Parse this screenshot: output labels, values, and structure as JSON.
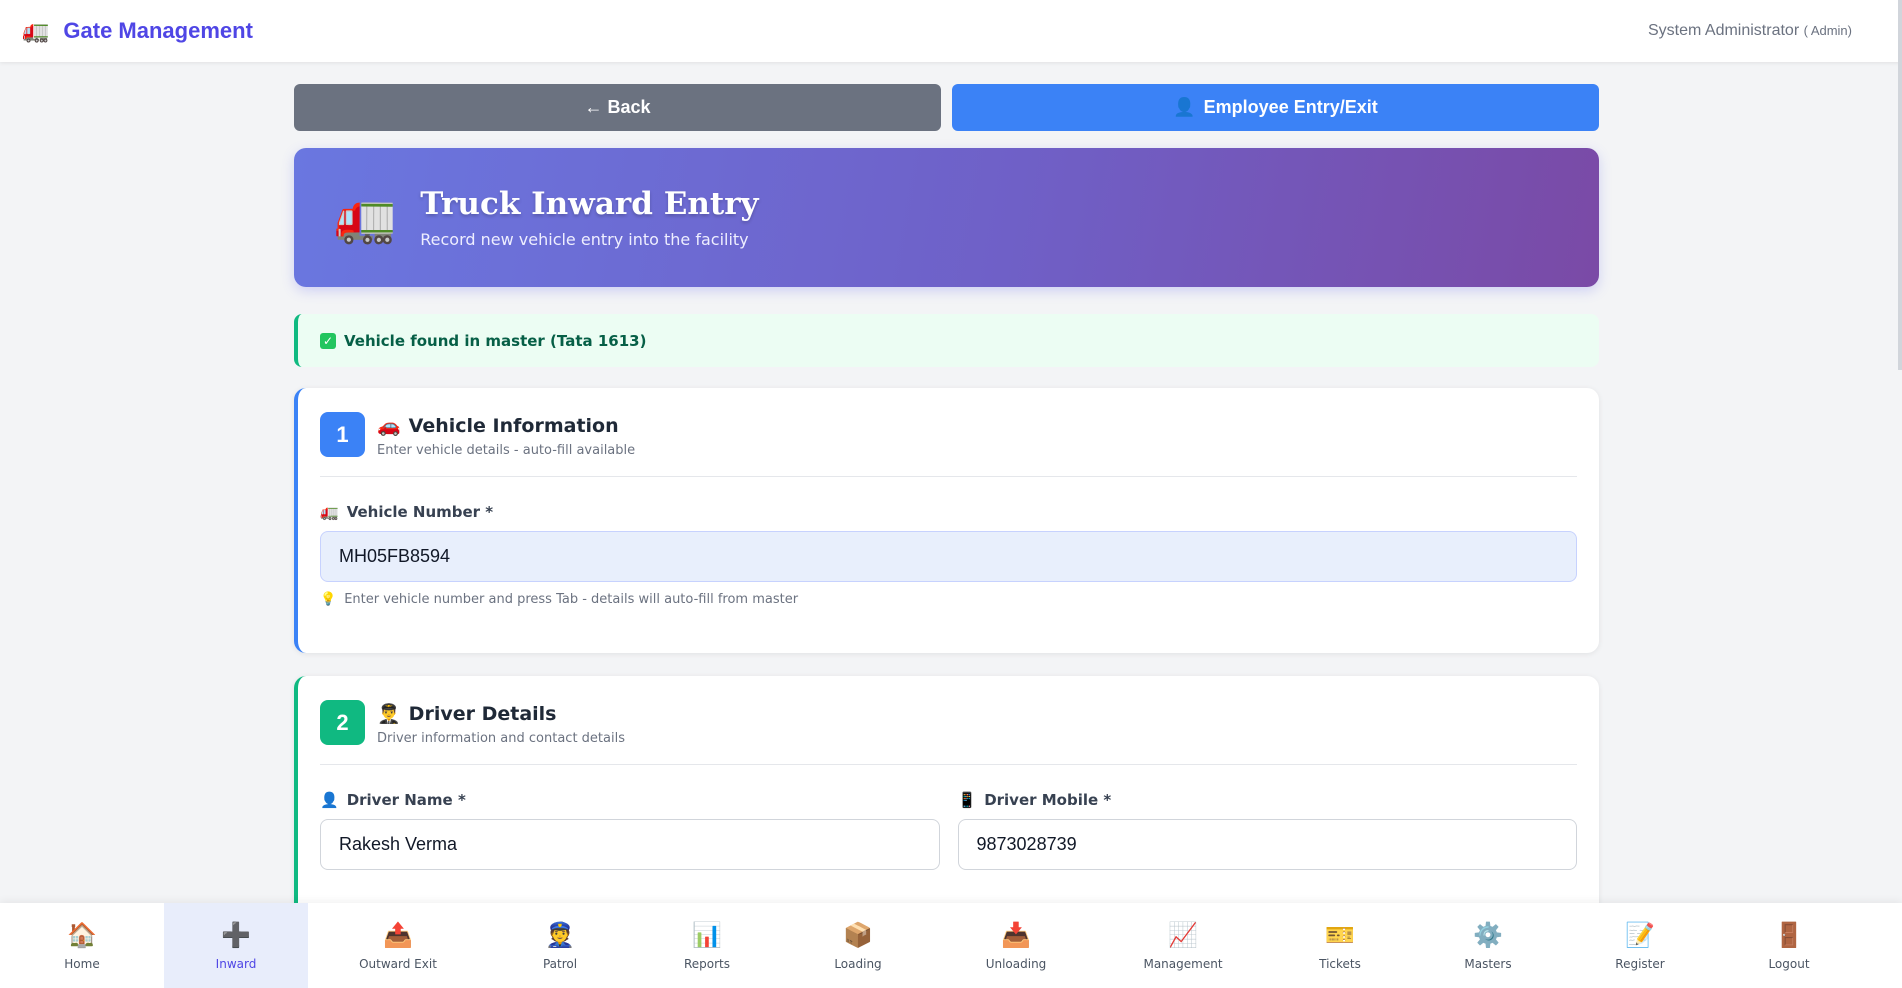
{
  "header": {
    "brand_icon": "🚛",
    "title": "Gate Management",
    "user_name": "System Administrator",
    "user_role": "( Admin)"
  },
  "actions": {
    "back_label": "← Back",
    "employee_icon": "👤",
    "employee_label": "Employee Entry/Exit"
  },
  "hero": {
    "icon": "🚛",
    "title": "Truck Inward Entry",
    "subtitle": "Record new vehicle entry into the facility"
  },
  "alert": {
    "icon": "✓",
    "text": "Vehicle found in master (Tata 1613)"
  },
  "vehicle_section": {
    "step": "1",
    "icon": "🚗",
    "title": "Vehicle Information",
    "subtitle": "Enter vehicle details - auto-fill available",
    "vehicle_number_icon": "🚛",
    "vehicle_number_label": "Vehicle Number *",
    "vehicle_number_value": "MH05FB8594",
    "hint_icon": "💡",
    "hint": "Enter vehicle number and press Tab - details will auto-fill from master"
  },
  "driver_section": {
    "step": "2",
    "icon": "👨‍✈️",
    "title": "Driver Details",
    "subtitle": "Driver information and contact details",
    "name_icon": "👤",
    "name_label": "Driver Name *",
    "name_value": "Rakesh Verma",
    "mobile_icon": "📱",
    "mobile_label": "Driver Mobile *",
    "mobile_value": "9873028739"
  },
  "nav": {
    "active": "Inward",
    "items": [
      {
        "icon": "🏠",
        "label": "Home"
      },
      {
        "icon": "➕",
        "label": "Inward"
      },
      {
        "icon": "📤",
        "label": "Outward Exit"
      },
      {
        "icon": "👮",
        "label": "Patrol"
      },
      {
        "icon": "📊",
        "label": "Reports"
      },
      {
        "icon": "📦",
        "label": "Loading"
      },
      {
        "icon": "📥",
        "label": "Unloading"
      },
      {
        "icon": "📈",
        "label": "Management"
      },
      {
        "icon": "🎫",
        "label": "Tickets"
      },
      {
        "icon": "⚙️",
        "label": "Masters"
      },
      {
        "icon": "📝",
        "label": "Register"
      },
      {
        "icon": "🚪",
        "label": "Logout"
      }
    ]
  },
  "colors": {
    "brand": "#4f46e5",
    "primary": "#3b82f6",
    "success": "#10b981",
    "back_button": "#6b7280"
  }
}
